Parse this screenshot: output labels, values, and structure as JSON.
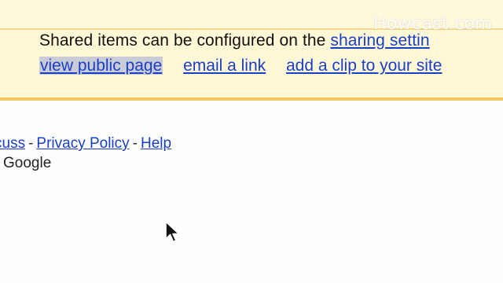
{
  "watermark": {
    "text": "Howcast.com"
  },
  "sharing_panel": {
    "info_prefix": "Shared items can be configured on the ",
    "sharing_settings_link": "sharing settin",
    "actions": {
      "view_public_page": "view public page",
      "email_a_link": "email a link",
      "add_a_clip": "add a clip to your site"
    }
  },
  "footer": {
    "discuss_link": "cuss",
    "separator": "-",
    "privacy_policy_link": "Privacy Policy",
    "help_link": "Help",
    "copyright": "Google"
  },
  "colors": {
    "link": "#1a3fc7",
    "panel_bg": "#fff8d6",
    "panel_border": "#f0c860",
    "selection": "#c9ccd6"
  }
}
